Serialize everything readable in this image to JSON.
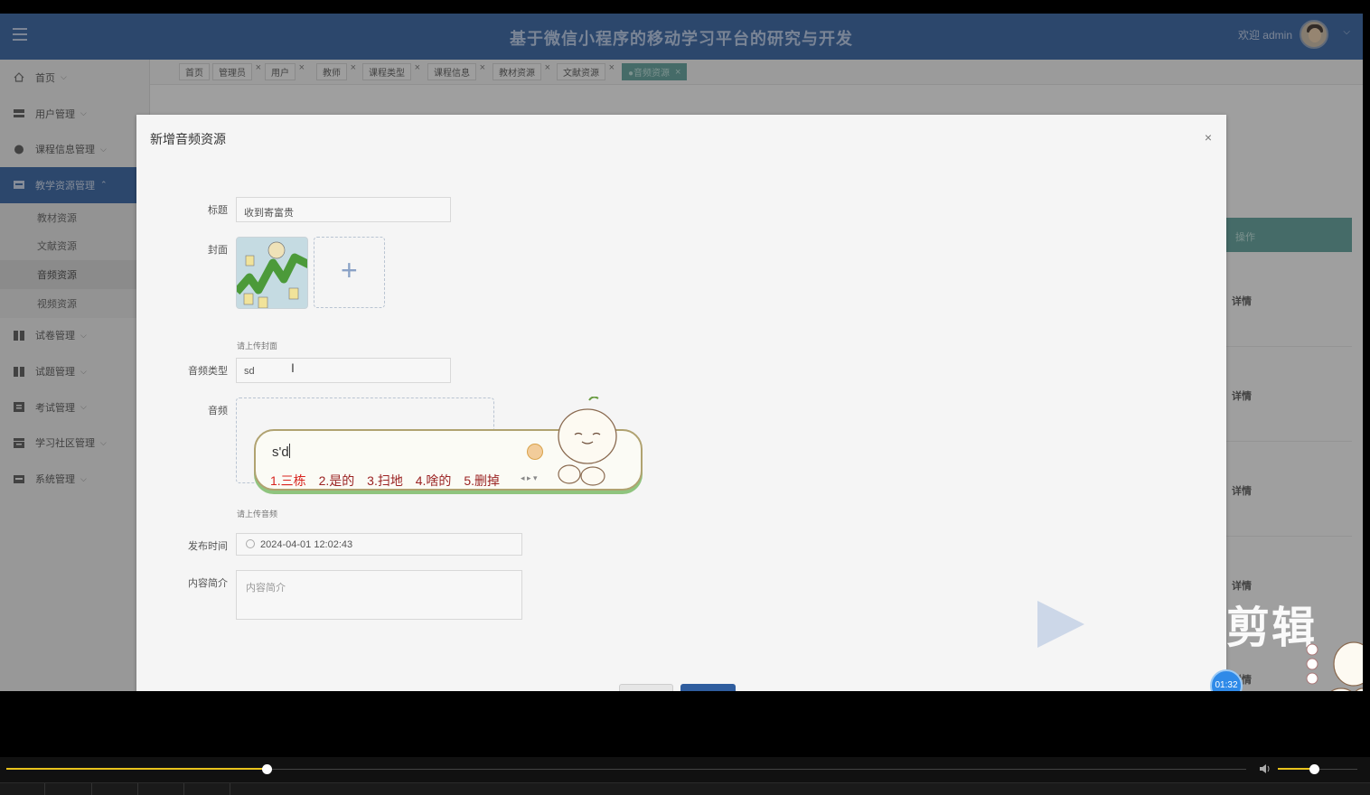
{
  "header": {
    "title": "基于微信小程序的移动学习平台的研究与开发",
    "welcome": "欢迎 admin"
  },
  "sidebar": {
    "items": [
      {
        "label": "首页"
      },
      {
        "label": "用户管理"
      },
      {
        "label": "课程信息管理"
      },
      {
        "label": "教学资源管理"
      },
      {
        "label": "试卷管理"
      },
      {
        "label": "试题管理"
      },
      {
        "label": "考试管理"
      },
      {
        "label": "学习社区管理"
      },
      {
        "label": "系统管理"
      }
    ],
    "sub_items": [
      {
        "label": "教材资源"
      },
      {
        "label": "文献资源"
      },
      {
        "label": "音频资源"
      },
      {
        "label": "视频资源"
      }
    ]
  },
  "tabs": [
    {
      "label": "首页"
    },
    {
      "label": "管理员"
    },
    {
      "label": "用户"
    },
    {
      "label": "教师"
    },
    {
      "label": "课程类型"
    },
    {
      "label": "课程信息"
    },
    {
      "label": "教材资源"
    },
    {
      "label": "文献资源"
    },
    {
      "label": "●音频资源"
    }
  ],
  "background_table": {
    "op_header": "操作",
    "detail_label": "详情"
  },
  "dialog": {
    "title": "新增音频资源",
    "close": "×",
    "fields": {
      "title_label": "标题",
      "title_value": "收到寄富贵",
      "cover_label": "封面",
      "cover_hint": "请上传封面",
      "type_label": "音频类型",
      "type_value": "sd",
      "audio_label": "音频",
      "audio_hint": "请上传音频",
      "date_label": "发布时间",
      "date_value": "2024-04-01 12:02:43",
      "intro_label": "内容简介",
      "intro_placeholder": "内容简介"
    }
  },
  "ime": {
    "composition": "s'd",
    "candidates": [
      "1.三栋",
      "2.是的",
      "3.扫地",
      "4.啥的",
      "5.删掉"
    ]
  },
  "overlay": {
    "watermark": "剪辑",
    "timer": "01:32"
  },
  "player": {
    "progress": 0.21,
    "volume": 0.45,
    "accent": "#e9c31c"
  },
  "colors": {
    "header": "#2f5d9e",
    "tab_active": "#5b9c96"
  }
}
